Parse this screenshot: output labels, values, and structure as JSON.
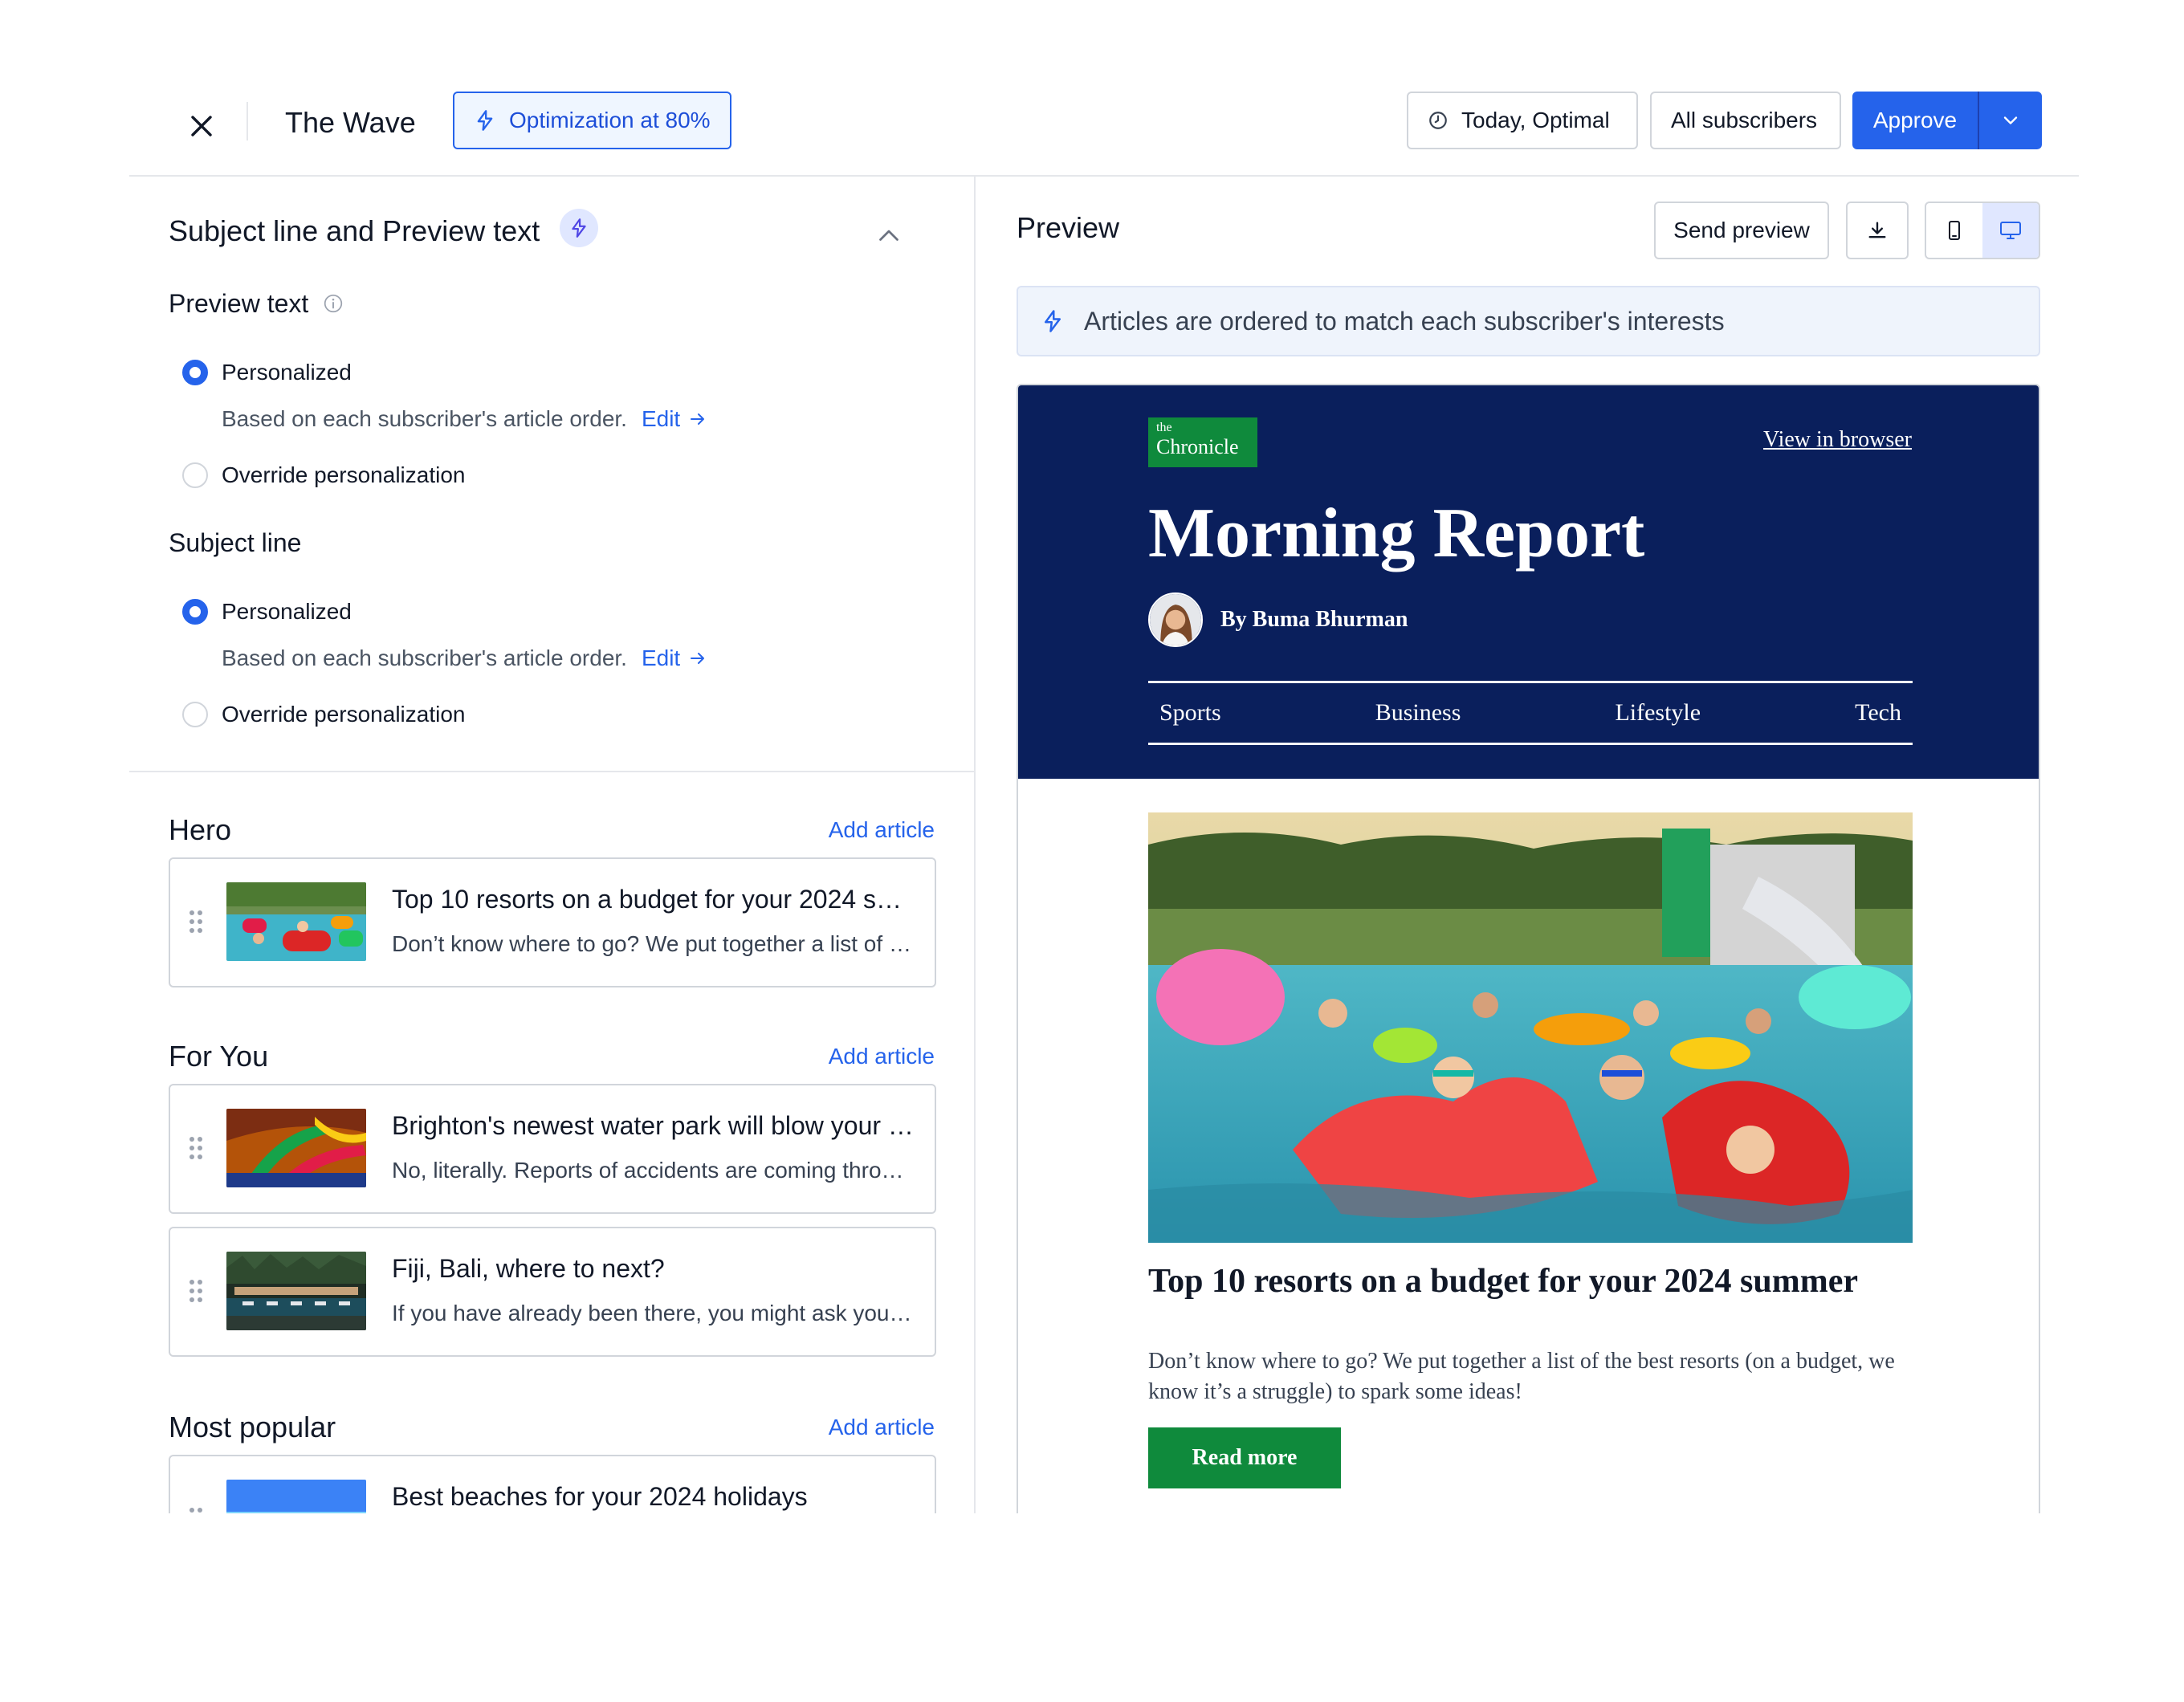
{
  "header": {
    "title": "The Wave",
    "optimization_label": "Optimization at 80%",
    "schedule_label": "Today, Optimal",
    "audience_label": "All subscribers",
    "approve_label": "Approve"
  },
  "settings": {
    "section_title": "Subject line and Preview text",
    "preview_text": {
      "label": "Preview text",
      "option_personalized": "Personalized",
      "helper": "Based on each subscriber's article order.",
      "edit_label": "Edit",
      "option_override": "Override personalization"
    },
    "subject_line": {
      "label": "Subject line",
      "option_personalized": "Personalized",
      "helper": "Based on each subscriber's article order.",
      "edit_label": "Edit",
      "option_override": "Override personalization"
    }
  },
  "sections": {
    "add_article_label": "Add article",
    "hero": {
      "title": "Hero",
      "articles": [
        {
          "title": "Top 10 resorts on a budget for your 2024 summer",
          "desc": "Don’t know where to go? We put together a list of the best resorts"
        }
      ]
    },
    "for_you": {
      "title": "For You",
      "articles": [
        {
          "title": "Brighton's newest water park will blow your mind",
          "desc": "No, literally. Reports of accidents are coming through"
        },
        {
          "title": "Fiji, Bali, where to next?",
          "desc": "If you have already been there, you might ask yourself"
        }
      ]
    },
    "most_popular": {
      "title": "Most popular",
      "articles": [
        {
          "title": "Best beaches for your 2024 holidays",
          "desc": ""
        }
      ]
    }
  },
  "preview": {
    "title": "Preview",
    "send_preview_label": "Send preview",
    "info_text": "Articles are ordered to match each subscriber's interests",
    "email": {
      "brand_small": "the",
      "brand_large": "Chronicle",
      "view_in_browser": "View in browser",
      "title": "Morning Report",
      "byline": "By Buma Bhurman",
      "nav": [
        "Sports",
        "Business",
        "Lifestyle",
        "Tech"
      ],
      "article_title": "Top 10 resorts on a budget for your 2024 summer",
      "article_body": "Don’t know where to go? We put together a list of the best resorts (on a budget, we know it’s a struggle) to spark some ideas!",
      "cta_label": "Read more"
    }
  },
  "colors": {
    "accent": "#2563eb",
    "email_header_bg": "#0a1f5c",
    "brand_green": "#0f8a3c"
  }
}
